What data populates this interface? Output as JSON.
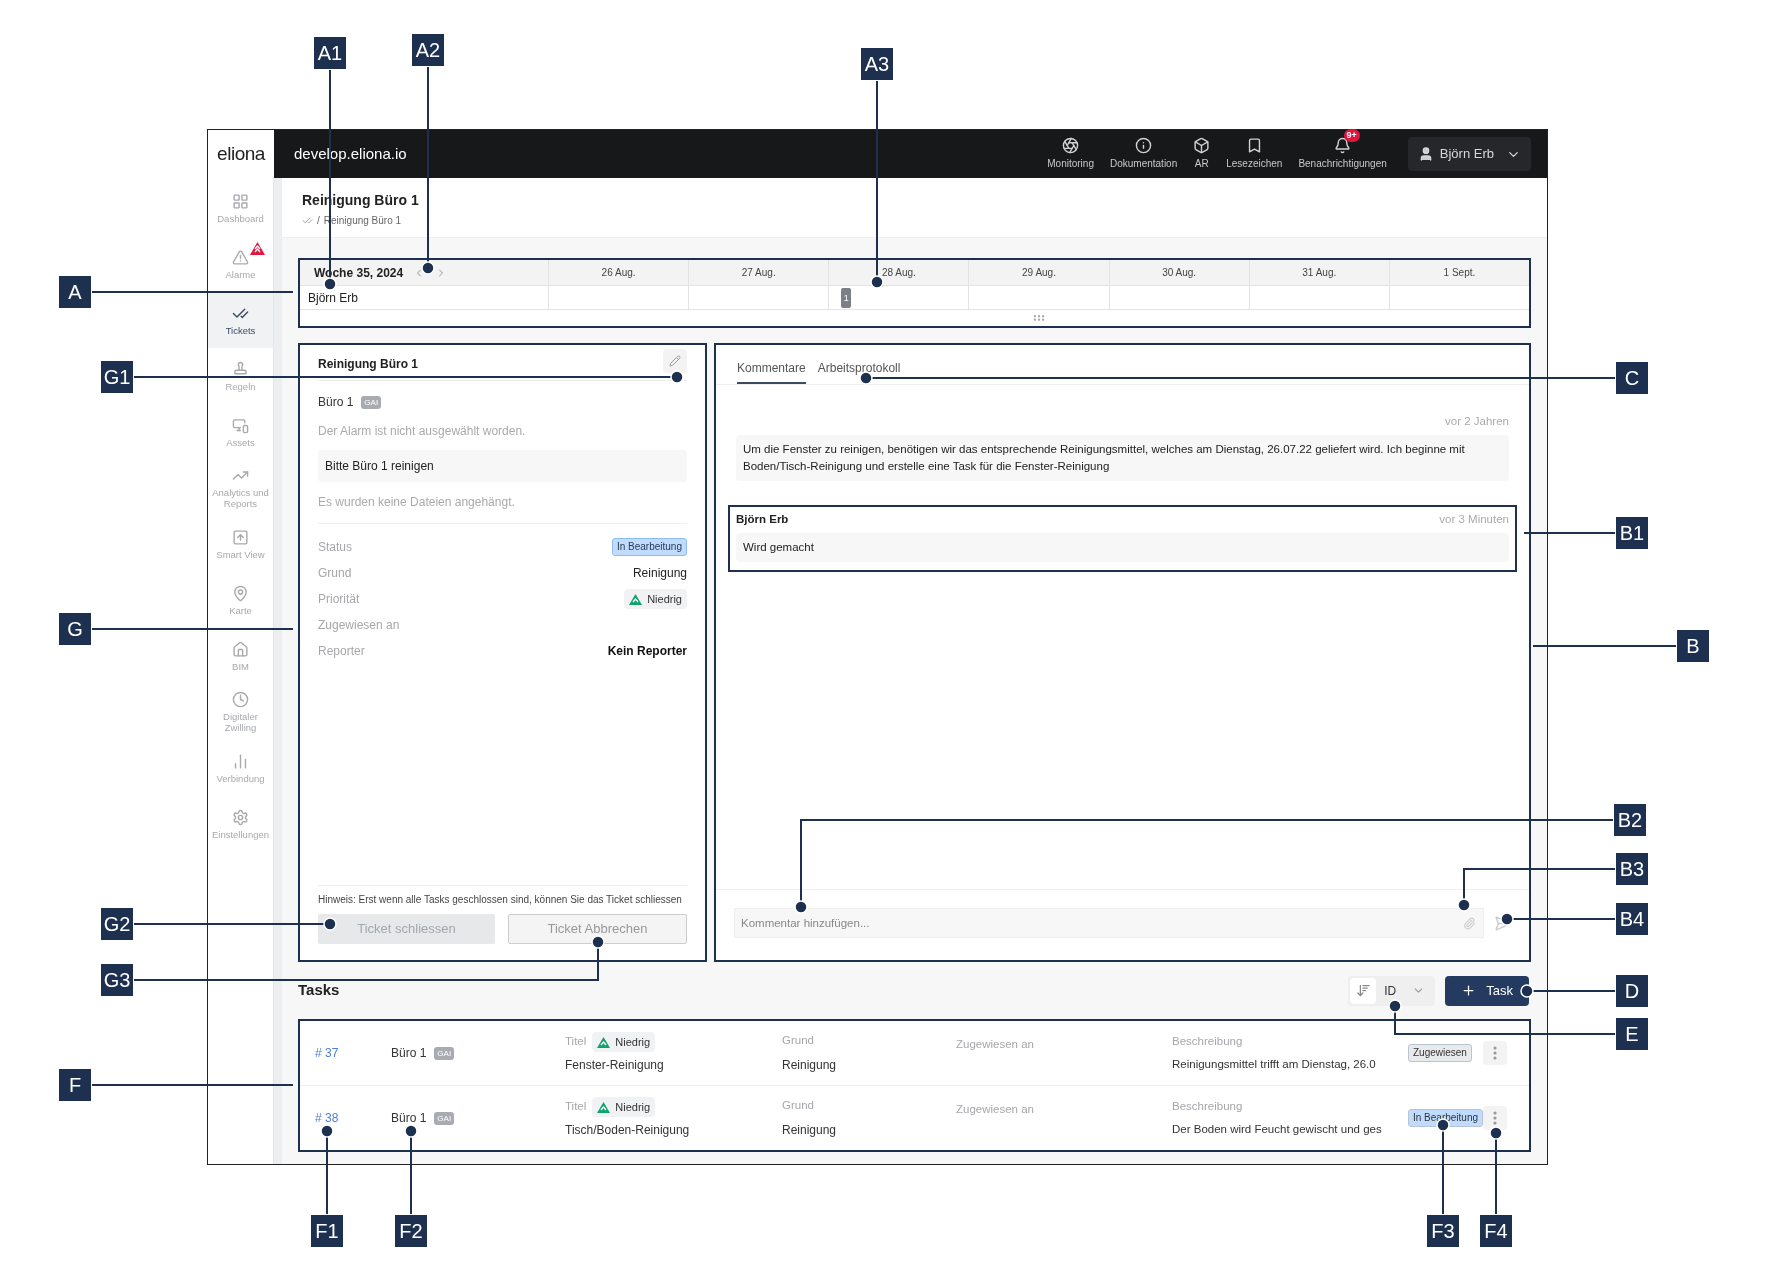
{
  "topbar": {
    "logo": "eliona",
    "domain": "develop.eliona.io",
    "nav": [
      {
        "label": "Monitoring"
      },
      {
        "label": "Dokumentation"
      },
      {
        "label": "AR"
      },
      {
        "label": "Lesezeichen"
      },
      {
        "label": "Benachrichtigungen",
        "badge": "9+"
      }
    ],
    "user": "Björn Erb"
  },
  "sidebar": {
    "items": [
      {
        "label": "Dashboard",
        "selected": false
      },
      {
        "label": "Alarme",
        "selected": false,
        "alert": true
      },
      {
        "label": "Tickets",
        "selected": true
      },
      {
        "label": "Regeln",
        "selected": false
      },
      {
        "label": "Assets",
        "selected": false
      },
      {
        "label": "Analytics und Reports",
        "selected": false
      },
      {
        "label": "Smart View",
        "selected": false
      },
      {
        "label": "Karte",
        "selected": false
      },
      {
        "label": "BIM",
        "selected": false
      },
      {
        "label": "Digitaler Zwilling",
        "selected": false
      },
      {
        "label": "Verbindung",
        "selected": false
      },
      {
        "label": "Einstellungen",
        "selected": false
      }
    ]
  },
  "page": {
    "title": "Reinigung Büro 1",
    "breadcrumb_separator": "/",
    "breadcrumb": "Reinigung Büro 1"
  },
  "calendar": {
    "week": "Woche 35, 2024",
    "person": "Björn Erb",
    "days": [
      {
        "label": "26 Aug."
      },
      {
        "label": "27 Aug."
      },
      {
        "label": "28 Aug.",
        "event": "1"
      },
      {
        "label": "29 Aug."
      },
      {
        "label": "30 Aug."
      },
      {
        "label": "31 Aug."
      },
      {
        "label": "1 Sept."
      }
    ]
  },
  "ticket": {
    "title": "Reinigung Büro 1",
    "location": "Büro 1",
    "tag": "GAI",
    "alarm_note": "Der Alarm ist nicht ausgewählt worden.",
    "description": "Bitte Büro 1 reinigen",
    "files_note": "Es wurden keine Dateien angehängt.",
    "fields": [
      {
        "label": "Status",
        "kind": "status",
        "value": "In Bearbeitung"
      },
      {
        "label": "Grund",
        "kind": "text",
        "value": "Reinigung"
      },
      {
        "label": "Priorität",
        "kind": "priority",
        "value": "Niedrig"
      },
      {
        "label": "Zugewiesen an",
        "kind": "text"
      },
      {
        "label": "Reporter",
        "kind": "strong",
        "value": "Kein Reporter"
      }
    ],
    "hint": "Hinweis: Erst wenn alle Tasks geschlossen sind, können Sie das Ticket schliessen",
    "buttons": [
      {
        "label": "Ticket schliessen",
        "disabled": true
      },
      {
        "label": "Ticket Abbrechen",
        "disabled": false
      }
    ]
  },
  "comments": {
    "tabs": [
      {
        "label": "Kommentare",
        "selected": true
      },
      {
        "label": "Arbeitsprotokoll",
        "selected": false
      }
    ],
    "items": [
      {
        "time": "vor 2 Jahren",
        "text": "Um die Fenster zu reinigen, benötigen wir das entsprechende Reinigungsmittel, welches am Dienstag, 26.07.22 geliefert wird. Ich beginne mit Boden/Tisch-Reinigung und erstelle eine Task für die Fenster-Reinigung",
        "highlighted": false
      },
      {
        "author": "Björn Erb",
        "time": "vor 3 Minuten",
        "text": "Wird gemacht",
        "highlighted": true
      }
    ],
    "input": {
      "placeholder": "Kommentar hinzufügen..."
    }
  },
  "tasks": {
    "title": "Tasks",
    "sort": "ID",
    "add_button": "Task",
    "rows": [
      {
        "id": "# 37",
        "location": "Büro 1",
        "tag": "GAI",
        "title_label": "Titel",
        "priority": "Niedrig",
        "title": "Fenster-Reinigung",
        "reason_label": "Grund",
        "reason": "Reinigung",
        "assignee_label": "Zugewiesen an",
        "description_label": "Beschreibung",
        "description": "Reinigungsmittel trifft am Dienstag, 26.0",
        "status": {
          "label": "Zugewiesen",
          "color": "#e9eaeb"
        }
      },
      {
        "id": "# 38",
        "location": "Büro 1",
        "tag": "GAI",
        "title_label": "Titel",
        "priority": "Niedrig",
        "title": "Tisch/Boden-Reinigung",
        "reason_label": "Grund",
        "reason": "Reinigung",
        "assignee_label": "Zugewiesen an",
        "description_label": "Beschreibung",
        "description": "Der Boden wird Feucht gewischt und ges",
        "status": {
          "label": "In Bearbeitung",
          "color": "#bfdcff"
        }
      }
    ]
  },
  "callouts": [
    {
      "label": "A1"
    },
    {
      "label": "A2"
    },
    {
      "label": "A3"
    },
    {
      "label": "A"
    },
    {
      "label": "G1"
    },
    {
      "label": "G"
    },
    {
      "label": "G2"
    },
    {
      "label": "G3"
    },
    {
      "label": "F"
    },
    {
      "label": "C"
    },
    {
      "label": "B1"
    },
    {
      "label": "B"
    },
    {
      "label": "B2"
    },
    {
      "label": "B3"
    },
    {
      "label": "B4"
    },
    {
      "label": "D"
    },
    {
      "label": "E"
    },
    {
      "label": "F1"
    },
    {
      "label": "F2"
    },
    {
      "label": "F3"
    },
    {
      "label": "F4"
    }
  ]
}
